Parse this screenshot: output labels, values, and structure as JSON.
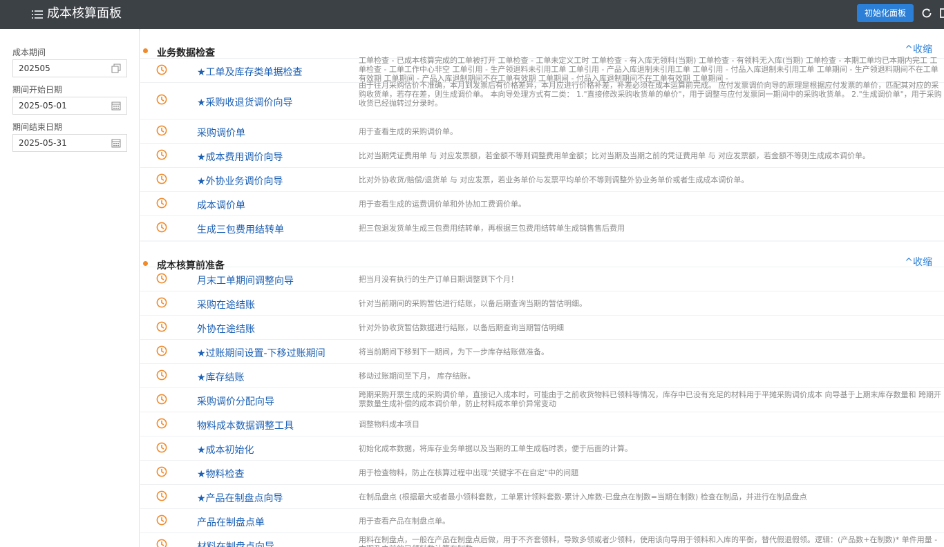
{
  "header": {
    "title": "成本核算面板",
    "init_button": "初始化面板"
  },
  "sidebar": {
    "period_label": "成本期间",
    "period_value": "202505",
    "start_label": "期间开始日期",
    "start_value": "2025-05-01",
    "end_label": "期间结束日期",
    "end_value": "2025-05-31"
  },
  "colors": {
    "accent": "#2b7fd6",
    "dot": "#f08a2b",
    "clock": "#f08a2b",
    "topbar": "#3c4146"
  },
  "sections": [
    {
      "title": "业务数据检查",
      "collapse": "^收缩",
      "items": [
        {
          "name": "★工单及库存类单据检查",
          "desc": "工单检查 - 已成本核算完成的工单被打开 工单检查 - 工单未定义工时 工单检查 - 有入库无领料(当期) 工单检查 - 有领料无入库(当期) 工单检查 - 本期工单均已本期内完工 工单检查 - 工单工作中心非空 工单引用 - 生产领退料未引用工单 工单引用 - 产品入库退制未引用工单 工单引用 - 付品入库退制未引用工单 工单期间 - 生产领退料期间不在工单有效期 工单期间 - 产品入库退制期间不在工单有效期 工单期间 - 付品入库退制期间不在工单有效期 工单期间 -"
        },
        {
          "name": "★采购收退货调价向导",
          "desc": "由于往月采购估价不准确，本月到发票后有价格差异，本月应进行价格补差，补差必须在成本运算前完成。 应付发票调价向导的原理是根据应付发票的单价，匹配其对应的采购收货单，若存在差，则生成调价单。 本向导处理方式有二类： 1.\"直接修改采购收货单的单价\"，用于调整与应付发票同一期间中的采购收货单。 2.\"生成调价单\"，用于采购收货已经抛转过分录时。"
        },
        {
          "name": "采购调价单",
          "desc": "用于查看生成的采购调价单。"
        },
        {
          "name": "★成本费用调价向导",
          "desc": "比对当期凭证费用单 与 对应发票额，若金额不等则调整费用单金额；比对当期及当期之前的凭证费用单 与 对应发票额，若金额不等则生成成本调价单。"
        },
        {
          "name": "★外协业务调价向导",
          "desc": "比对外协收货/赔偿/退货单 与 对应发票，若业务单价与发票平均单价不等则调整外协业务单价或者生成成本调价单。"
        },
        {
          "name": "成本调价单",
          "desc": "用于查看生成的运费调价单和外协加工费调价单。"
        },
        {
          "name": "生成三包费用结转单",
          "desc": "把三包退发货单生成三包费用结转单，再根据三包费用结转单生成销售售后费用"
        }
      ]
    },
    {
      "title": "成本核算前准备",
      "collapse": "^收缩",
      "items": [
        {
          "name": "月末工单期间调整向导",
          "desc": "把当月没有执行的生产订单日期调整到下个月！"
        },
        {
          "name": "采购在途结账",
          "desc": "针对当前期间的采购暂估进行结账，以备后期查询当期的暂估明细。"
        },
        {
          "name": "外协在途结账",
          "desc": "针对外协收货暂估数据进行结账，以备后期查询当期暂估明细"
        },
        {
          "name": "★过账期间设置-下移过账期间",
          "desc": "将当前期间下移到下一期间，为下一步库存结账做准备。"
        },
        {
          "name": "★库存结账",
          "desc": "移动过账期间至下月， 库存结账。"
        },
        {
          "name": "采购调价分配向导",
          "desc": "跨期采购开票生成的采购调价单，直接记入成本时，可能由于之前收货物料已领料等情况，库存中已没有充足的材料用于平摊采购调价成本 向导基于上期末库存数量和 跨期开票数量生成补偿的成本调价单，防止材料成本单价异常变动"
        },
        {
          "name": "物料成本数据调整工具",
          "desc": "调整物料成本项目"
        },
        {
          "name": "★成本初始化",
          "desc": "初始化成本数据，将库存业务单据以及当期的工单生成临时表，便于后面的计算。"
        },
        {
          "name": "★物料检查",
          "desc": "用于检查物料，防止在核算过程中出现\"关键字不在自定\"中的问题"
        },
        {
          "name": "★产品在制盘点向导",
          "desc": "在制品盘点 (根据最大或者最小领料套数，工单累计领料套数-累计入库数-已盘点在制数=当期在制数) 检查在制品，并进行在制品盘点"
        },
        {
          "name": "产品在制盘点单",
          "desc": "用于查看产品在制盘点单。"
        },
        {
          "name": "材料在制盘点向导",
          "desc": "用料在制盘点，一般在产品在制盘点后做，用于不齐套领料，导致多领或者少领料，使用该向导用于领料和入库的平衡，替代假退假领。逻辑：(产品数+在制数)* 单件用量 - 本期及之前的已领料数计算在制数"
        }
      ]
    }
  ]
}
